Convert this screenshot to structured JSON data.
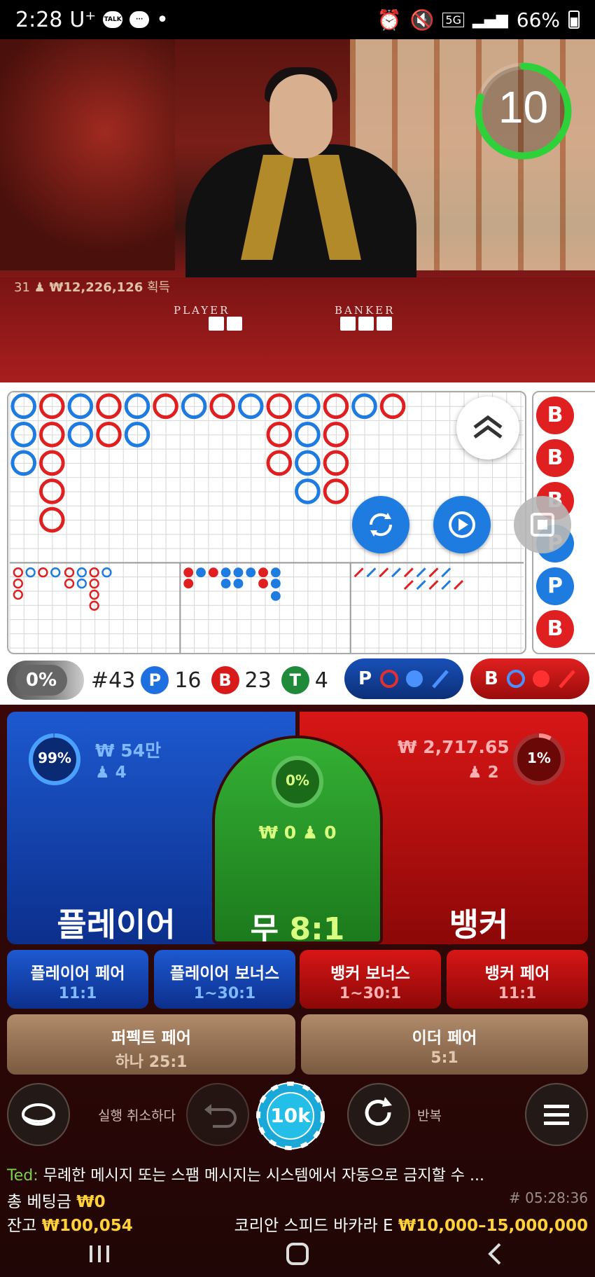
{
  "status_bar": {
    "time": "2:28",
    "carrier": "U⁺",
    "network": "5G",
    "battery": "66%",
    "talk_icon_text": "TALK"
  },
  "video": {
    "timer_value": "10",
    "timer_progress": 0.8,
    "winners_count": "31",
    "winners_amount": "₩12,226,126",
    "winners_suffix": "획득",
    "felt_player": "PLAYER",
    "felt_banker": "BANKER"
  },
  "roadmap": {
    "bead_p": "P",
    "bead_b": "B"
  },
  "stats": {
    "percent": "0%",
    "round": "#43",
    "player_letter": "P",
    "player_count": "16",
    "banker_letter": "B",
    "banker_count": "23",
    "tie_letter": "T",
    "tie_count": "4",
    "p_ask_letter": "P",
    "b_ask_letter": "B"
  },
  "bets": {
    "player": {
      "percent": "99%",
      "amount": "₩ 54만",
      "players": "4",
      "label": "플레이어",
      "percent_value": 0.99
    },
    "tie": {
      "percent": "0%",
      "amount": "₩ 0",
      "players": "0",
      "label": "무",
      "payout": "8:1",
      "percent_value": 0.0
    },
    "banker": {
      "percent": "1%",
      "amount": "₩ 2,717.65",
      "players": "2",
      "label": "뱅커",
      "percent_value": 0.01
    },
    "side": [
      {
        "name": "플레이어 페어",
        "payout": "11:1"
      },
      {
        "name": "플레이어 보너스",
        "payout": "1~30:1"
      },
      {
        "name": "뱅커 보너스",
        "payout": "1~30:1"
      },
      {
        "name": "뱅커 페어",
        "payout": "11:1"
      }
    ],
    "perfect_pair": {
      "name": "퍼펙트 페어",
      "payout": "하나 25:1"
    },
    "either_pair": {
      "name": "이더 페어",
      "payout": "5:1"
    }
  },
  "controls": {
    "undo_label": "실행 취소하다",
    "chip_value": "10k",
    "repeat_label": "반복"
  },
  "footer": {
    "chat_user": "Ted:",
    "chat_message": "무례한 메시지 또는 스팸 메시지는 시스템에서 자동으로 금지할 수 ...",
    "total_bet_label": "총 베팅금",
    "total_bet_value": "₩0",
    "game_id": "# 05:28:36",
    "balance_label": "잔고",
    "balance_value": "₩100,054",
    "table_name": "코리안 스피드 바카라 E",
    "table_limits": "₩10,000–15,000,000"
  },
  "colors": {
    "player": "#1c54c8",
    "banker": "#d01818",
    "tie": "#2a9a2a",
    "accent_yellow": "#ffd23a"
  }
}
